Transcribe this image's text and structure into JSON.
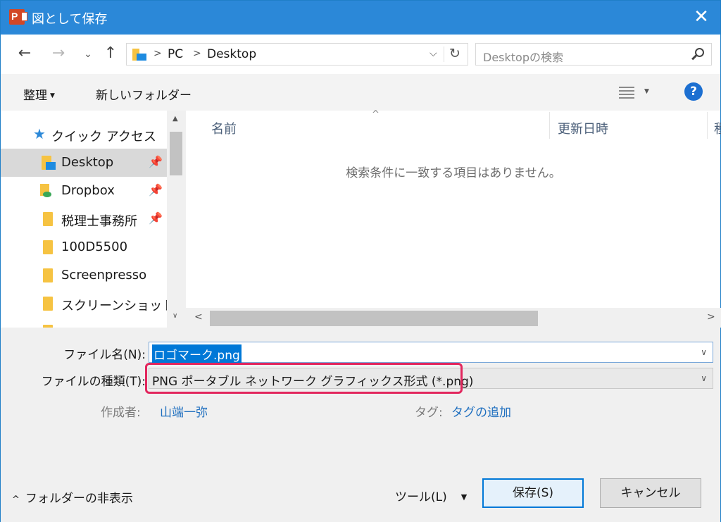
{
  "window": {
    "title": "図として保存",
    "app_icon_letter": "P",
    "close_glyph": "✕"
  },
  "nav": {
    "back_glyph": "←",
    "forward_glyph": "→",
    "recent_glyph": "⌄",
    "up_glyph": "↑",
    "breadcrumb": [
      "PC",
      "Desktop"
    ],
    "separator_glyph": ">",
    "dropdown_glyph": "⌵",
    "refresh_glyph": "↻",
    "search_placeholder": "Desktopの検索"
  },
  "commandbar": {
    "organize_label": "整理",
    "organize_caret": "▼",
    "new_folder_label": "新しいフォルダー",
    "view_caret": "▼",
    "help_label": "?"
  },
  "sidebar": {
    "quick_access_label": "クイック アクセス",
    "star_glyph": "★",
    "pin_glyph": "📌",
    "items": [
      {
        "label": "Desktop",
        "icon": "desktop-folder-icon",
        "pinned": true,
        "selected": true
      },
      {
        "label": "Dropbox",
        "icon": "dropbox-folder-icon",
        "pinned": true
      },
      {
        "label": "税理士事務所",
        "icon": "folder-icon",
        "pinned": true
      },
      {
        "label": "100D5500",
        "icon": "folder-icon"
      },
      {
        "label": "Screenpresso",
        "icon": "folder-icon"
      },
      {
        "label": "スクリーンショット",
        "icon": "folder-icon"
      }
    ],
    "scroll_up_glyph": "▲",
    "scroll_down_glyph": "∨"
  },
  "filelist": {
    "columns": [
      "名前",
      "更新日時",
      "種"
    ],
    "sort_glyph": "^",
    "empty_message": "検索条件に一致する項目はありません。",
    "scroll_left_glyph": "<",
    "scroll_right_glyph": ">"
  },
  "form": {
    "filename_label": "ファイル名(N):",
    "filename_value": "ロゴマーク.png",
    "filetype_label": "ファイルの種類(T):",
    "filetype_value": "PNG ポータブル ネットワーク グラフィックス形式 (*.png)",
    "dropdown_glyph": "∨",
    "author_label": "作成者:",
    "author_value": "山端一弥",
    "tag_label": "タグ:",
    "tag_value": "タグの追加",
    "highlight_color": "#e2265d"
  },
  "footer": {
    "hide_folders_glyph": "^",
    "hide_folders_label": "フォルダーの非表示",
    "tools_label": "ツール(L)",
    "tools_glyph": "▼",
    "save_label": "保存(S)",
    "cancel_label": "キャンセル"
  },
  "colors": {
    "titlebar": "#2b88d8",
    "accent": "#0078d7",
    "link": "#1f6fbf"
  }
}
